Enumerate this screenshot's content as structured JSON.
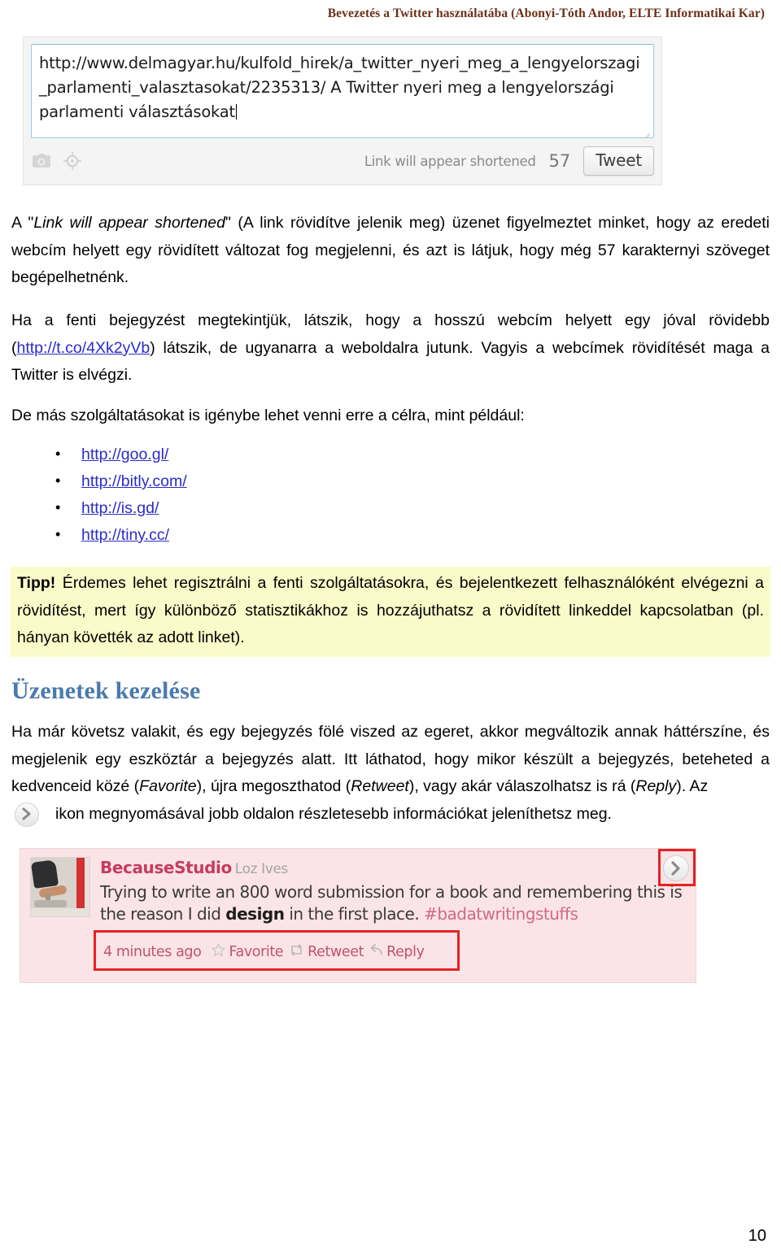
{
  "header": {
    "running_title": "Bevezetés a Twitter használatába (Abonyi-Tóth Andor, ELTE Informatikai Kar)"
  },
  "compose": {
    "textarea_value": "http://www.delmagyar.hu/kulfold_hirek/a_twitter_nyeri_meg_a_lengyelorszagi_parlamenti_valasztasokat/2235313/ A Twitter nyeri meg a lengyelországi parlamenti választásokat",
    "camera_icon": "camera-icon",
    "geo_icon": "crosshair-location-icon",
    "shorten_note": "Link will appear shortened",
    "char_count": "57",
    "tweet_button": "Tweet"
  },
  "paragraphs": {
    "p1_a": "A \"",
    "p1_em": "Link will appear shortened",
    "p1_b": "\" (A link rövidítve jelenik meg) üzenet figyelmeztet minket, hogy az eredeti webcím helyett egy rövidített változat fog megjelenni, és azt is látjuk, hogy még 57 karakternyi szöveget begépelhetnénk.",
    "p2_a": "Ha a fenti bejegyzést megtekintjük, látszik, hogy a hosszú webcím helyett egy jóval rövidebb (",
    "p2_link": "http://t.co/4Xk2yVb",
    "p2_b": ") látszik, de ugyanarra a weboldalra jutunk. Vagyis a webcímek rövidítését maga a Twitter is elvégzi.",
    "p3": "De más szolgáltatásokat is igénybe lehet venni erre a célra, mint például:",
    "p4": "Ha már követsz valakit, és egy bejegyzés fölé viszed az egeret, akkor megváltozik annak háttérszíne, és megjelenik egy eszköztár a bejegyzés alatt. Itt láthatod, hogy mikor készült a bejegyzés, beteheted a kedvenceid közé (",
    "p4_em1": "Favorite",
    "p4_mid1": "), újra megoszthatod (",
    "p4_em2": "Retweet",
    "p4_mid2": "), vagy akár válaszolhatsz is rá (",
    "p4_em3": "Reply",
    "p4_end": "). Az",
    "p5": "ikon megnyomásával jobb oldalon részletesebb információkat jeleníthetsz meg."
  },
  "shortener_links": [
    "http://goo.gl/",
    "http://bitly.com/",
    "http://is.gd/",
    "http://tiny.cc/"
  ],
  "tip": {
    "label": "Tipp!",
    "text": " Érdemes lehet regisztrálni a fenti szolgáltatásokra, és bejelentkezett felhasználóként elvégezni a rövidítést, mert így különböző statisztikákhoz is hozzájuthatsz a rövidített linkeddel kapcsolatban (pl. hányan követték az adott linket)."
  },
  "section": {
    "heading": "Üzenetek kezelése"
  },
  "tweet": {
    "avatar": "office-chair-photo",
    "username": "BecauseStudio",
    "realname": "Loz Ives",
    "body_a": "Trying to write an 800 word submission for a book and remembering this is the reason I did ",
    "body_bold": "design",
    "body_b": " in the first place. ",
    "hashtag": "#badatwritingstuffs",
    "timestamp": "4 minutes ago",
    "favorite_label": "Favorite",
    "retweet_label": "Retweet",
    "reply_label": "Reply",
    "detail_icon": "chevron-right-circle-icon"
  },
  "footer": {
    "page_number": "10"
  },
  "colors": {
    "header_brown": "#6b2f17",
    "link_blue": "#2b2bc8",
    "tip_yellow": "#fbfbc9",
    "heading_blue": "#4a7aad",
    "tweet_pink_bg": "#fbe4e8",
    "tweet_user_pink": "#c63b5e",
    "highlight_red": "#e52222"
  }
}
